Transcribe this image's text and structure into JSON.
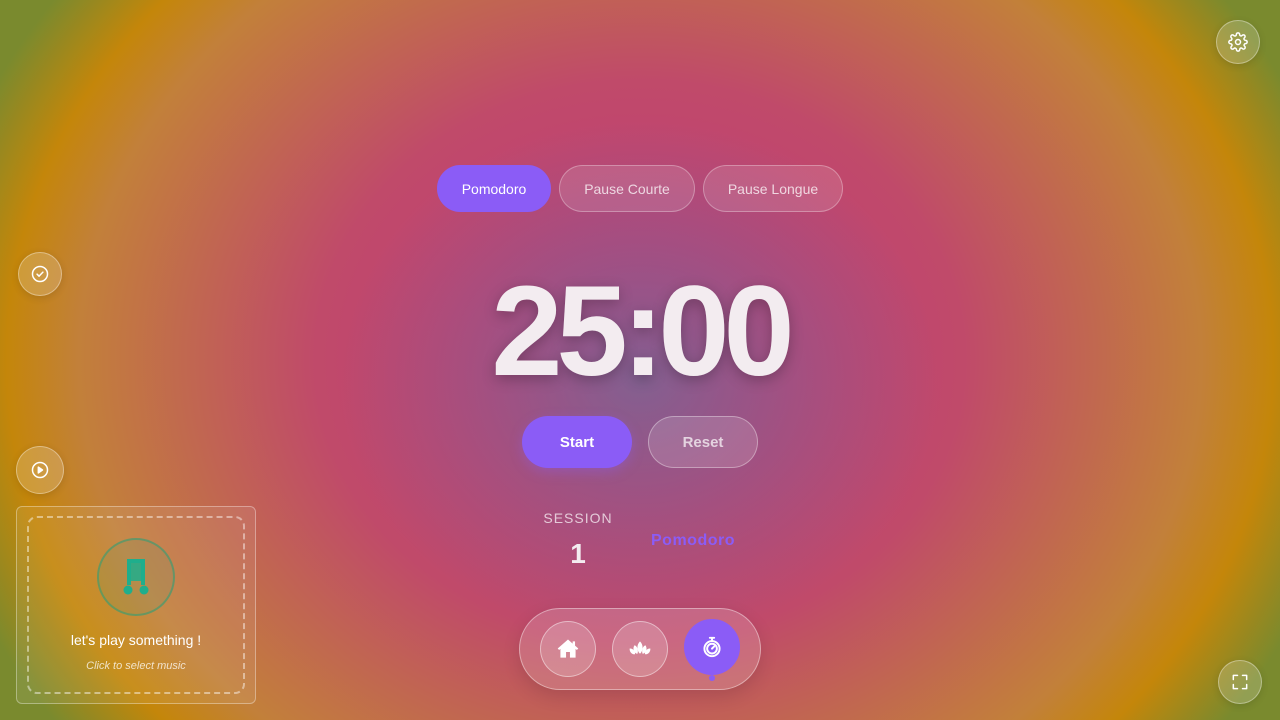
{
  "tabs": [
    {
      "label": "Pomodoro",
      "active": true
    },
    {
      "label": "Pause Courte",
      "active": false
    },
    {
      "label": "Pause Longue",
      "active": false
    }
  ],
  "timer": {
    "display": "25:00"
  },
  "controls": {
    "start_label": "Start",
    "reset_label": "Reset"
  },
  "session": {
    "label": "SESSION",
    "number": "1",
    "mode": "Pomodoro"
  },
  "music": {
    "title": "let's play something !",
    "subtitle": "Click to select music"
  },
  "icons": {
    "settings": "gear-icon",
    "tasks": "check-circle-icon",
    "play": "play-circle-icon",
    "fullscreen": "expand-icon",
    "home": "home-icon",
    "lotus": "lotus-icon",
    "timer": "stopwatch-icon",
    "music": "music-note-icon"
  },
  "colors": {
    "accent": "#8b5cf6",
    "music_icon": "#1fae8c"
  }
}
